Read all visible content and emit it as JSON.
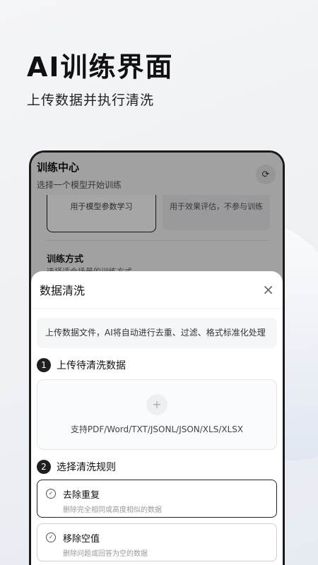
{
  "hero": {
    "title": "AI训练界面",
    "subtitle": "上传数据并执行清洗"
  },
  "app": {
    "title": "训练中心",
    "subtitle": "选择一个模型开始训练",
    "header_icon": "refresh-icon"
  },
  "background_cards": {
    "card_a": "用于模型参数学习",
    "card_b": "用于效果评估，不参与训练",
    "section_title": "训练方式",
    "section_subtitle": "选择适合场景的训练方式"
  },
  "sheet": {
    "title": "数据清洗",
    "close": "×",
    "info": "上传数据文件，AI将自动进行去重、过滤、格式标准化处理",
    "step1": {
      "num": "1",
      "label": "上传待清洗数据"
    },
    "upload": {
      "plus": "+",
      "hint": "支持PDF/Word/TXT/JSONL/JSON/XLS/XLSX"
    },
    "step2": {
      "num": "2",
      "label": "选择清洗规则"
    },
    "rules": [
      {
        "title": "去除重复",
        "desc": "删除完全相同或高度相似的数据"
      },
      {
        "title": "移除空值",
        "desc": "删除问题或回答为空的数据"
      }
    ]
  }
}
